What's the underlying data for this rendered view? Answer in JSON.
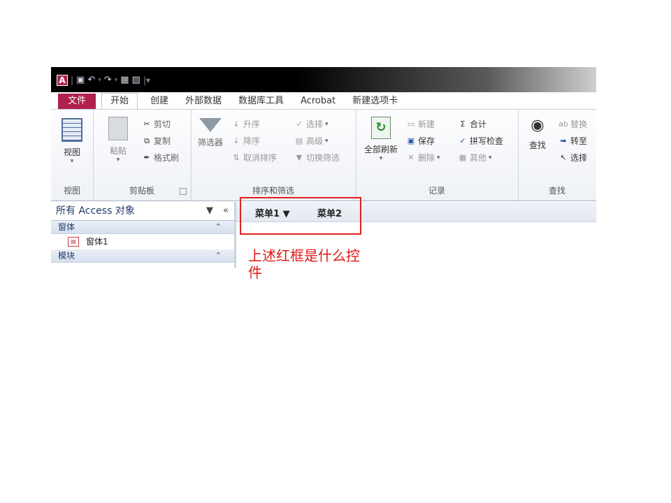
{
  "quick_access": {
    "logo": "A",
    "icons": [
      "save-icon",
      "undo-icon",
      "redo-icon",
      "customize-icon"
    ]
  },
  "tabs": [
    "文件",
    "开始",
    "创建",
    "外部数据",
    "数据库工具",
    "Acrobat",
    "新建选项卡"
  ],
  "ribbon": {
    "view": {
      "button": "视图",
      "group": "视图"
    },
    "clipboard": {
      "paste": "粘贴",
      "cut": "剪切",
      "copy": "复制",
      "format_painter": "格式刷",
      "group": "剪贴板"
    },
    "sort_filter": {
      "filter": "筛选器",
      "ascending": "升序",
      "descending": "降序",
      "clear_sort": "取消排序",
      "selection": "选择",
      "advanced": "高级",
      "toggle_filter": "切换筛选",
      "group": "排序和筛选"
    },
    "records": {
      "refresh_all": "全部刷新",
      "new": "新建",
      "save": "保存",
      "delete": "删除",
      "totals": "合计",
      "spelling": "拼写检查",
      "more": "其他",
      "group": "记录"
    },
    "find": {
      "find": "查找",
      "replace": "替换",
      "goto": "转至",
      "select": "选择",
      "group": "查找"
    }
  },
  "nav_pane": {
    "title": "所有 Access 对象",
    "groups": [
      {
        "name": "窗体",
        "items": [
          "窗体1"
        ]
      },
      {
        "name": "模块",
        "items": []
      }
    ]
  },
  "doc_tabs": [
    "菜单1 ▼",
    "菜单2"
  ],
  "annotation": {
    "caption": "上述红框是什么控件"
  },
  "colors": {
    "file_tab": "#b0204c",
    "annotation": "#e02020"
  }
}
